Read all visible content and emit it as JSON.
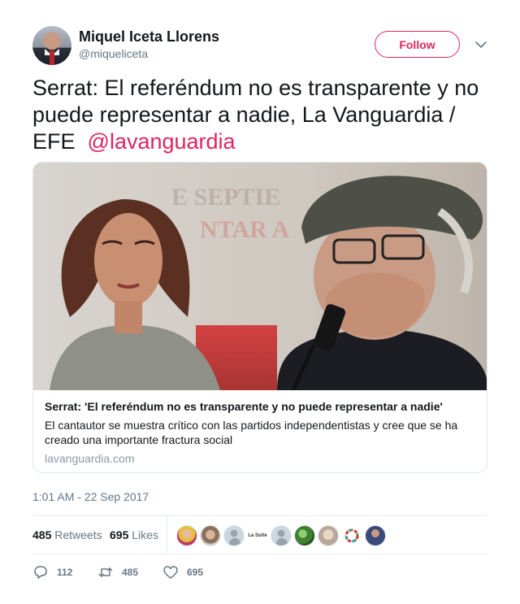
{
  "author": {
    "name": "Miquel Iceta Llorens",
    "handle": "@miqueliceta",
    "avatar_icon": "profile-photo"
  },
  "follow_button": {
    "label": "Follow",
    "color": "#e0245e"
  },
  "tweet": {
    "text": "Serrat: El referéndum no es transparente y no puede representar a nadie, La Vanguardia / EFE",
    "mention": "@lavanguardia"
  },
  "card": {
    "image_icon": "news-photo",
    "image_overlay_text": [
      "E SEPTIE",
      "NTAR A"
    ],
    "title": "Serrat: 'El referéndum no es transparente y no puede representar a nadie'",
    "description": "El cantautor se muestra crítico con las partidos independentistas y cree que se ha creado una importante fractura social",
    "domain": "lavanguardia.com"
  },
  "timestamp": "1:01 AM - 22 Sep 2017",
  "stats": {
    "retweets_count": "485",
    "retweets_label": "Retweets",
    "likes_count": "695",
    "likes_label": "Likes"
  },
  "likers_strip": {
    "text_avatar_label": "La Suite"
  },
  "actions": {
    "reply_count": "112",
    "retweet_count": "485",
    "like_count": "695"
  },
  "colors": {
    "accent": "#e0245e",
    "secondary_text": "#657786",
    "border": "#e6ecf0"
  }
}
